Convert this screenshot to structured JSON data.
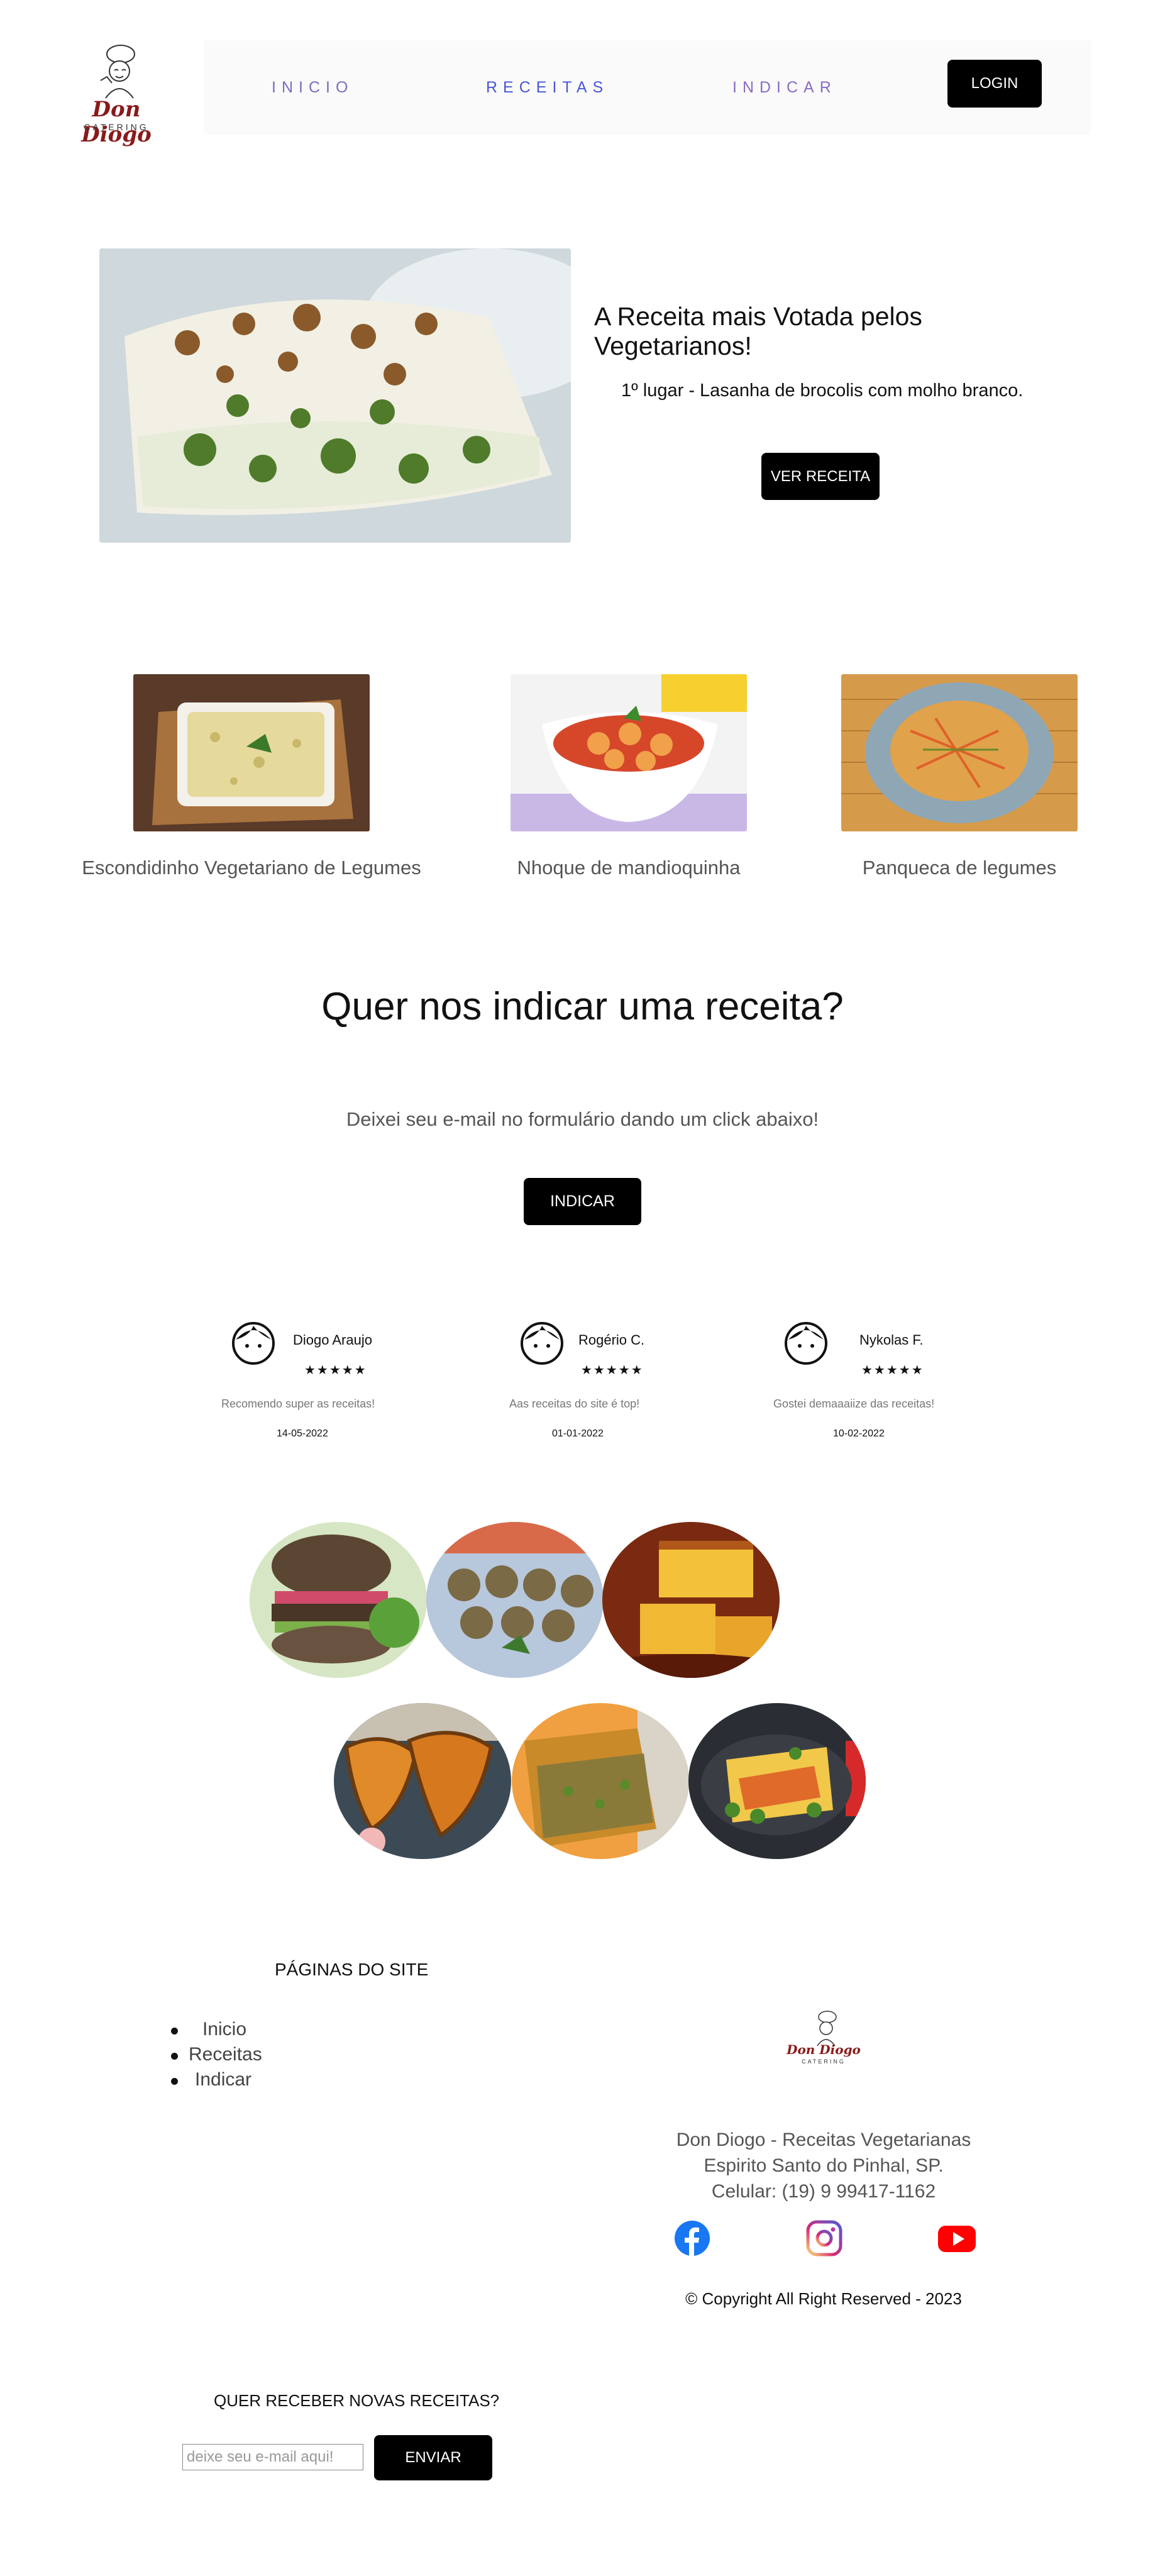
{
  "brand": {
    "logo_name": "Don Diogo",
    "logo_sub": "CATERING"
  },
  "nav": {
    "inicio": "INICIO",
    "receitas": "RECEITAS",
    "indicar": "INDICAR",
    "login": "LOGIN"
  },
  "hero": {
    "title": "A Receita mais Votada pelos Vegetarianos!",
    "subtitle": "1º lugar - Lasanha de brocolis com molho branco.",
    "button": "VER RECEITA"
  },
  "recipes": [
    {
      "label": "Escondidinho Vegetariano de Legumes"
    },
    {
      "label": "Nhoque de mandioquinha"
    },
    {
      "label": "Panqueca de legumes"
    }
  ],
  "indicar": {
    "title": "Quer nos indicar uma receita?",
    "subtitle": "Deixei seu e-mail no formulário dando um click abaixo!",
    "button": "INDICAR"
  },
  "reviews": [
    {
      "name": "Diogo Araujo",
      "stars": "★★★★★",
      "text": "Recomendo super as receitas!",
      "date": "14-05-2022"
    },
    {
      "name": "Rogério C.",
      "stars": "★★★★★",
      "text": "Aas receitas do site é top!",
      "date": "01-01-2022"
    },
    {
      "name": "Nykolas F.",
      "stars": "★★★★★",
      "text": "Gostei demaaaiize das receitas!",
      "date": "10-02-2022"
    }
  ],
  "footer": {
    "heading": "PÁGINAS DO SITE",
    "links": [
      "Inicio",
      "Receitas",
      "Indicar"
    ],
    "info_line1": "Don Diogo - Receitas Vegetarianas",
    "info_line2": "Espirito Santo do Pinhal, SP.",
    "info_line3": "Celular: (19) 9 99417-1162",
    "copyright": "© Copyright All Right Reserved - 2023"
  },
  "newsletter": {
    "heading": "QUER RECEBER NOVAS RECEITAS?",
    "placeholder": "deixe seu e-mail aqui!",
    "button": "ENVIAR"
  },
  "colors": {
    "accent_nav": "#6a5acd",
    "button_bg": "#000000",
    "logo_red": "#8a1a1a"
  },
  "icons": [
    "chef-logo",
    "user-face-icon",
    "facebook-icon",
    "instagram-icon",
    "youtube-icon"
  ]
}
